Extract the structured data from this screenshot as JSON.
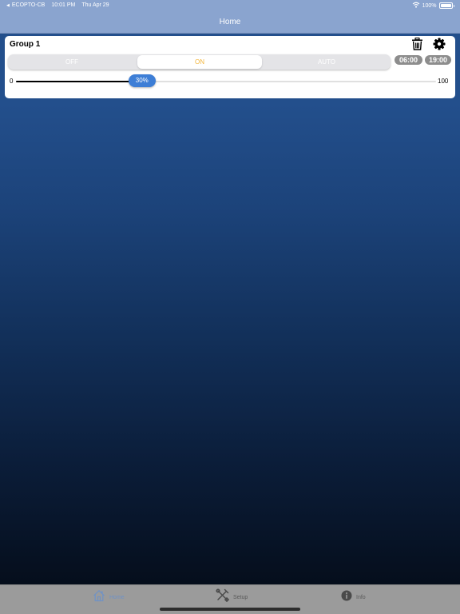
{
  "status_bar": {
    "back_app": "ECOPTO-CB",
    "time": "10:01 PM",
    "date": "Thu Apr 29",
    "battery": "100%",
    "icons": [
      "back-carat-icon",
      "wifi-icon",
      "battery-icon"
    ]
  },
  "nav": {
    "title": "Home"
  },
  "group": {
    "name": "Group 1",
    "mode_options": [
      "OFF",
      "ON",
      "AUTO"
    ],
    "selected_mode": "ON",
    "schedule_start": "06:00",
    "schedule_end": "19:00",
    "slider_min": "0",
    "slider_max": "100",
    "slider_value": 30,
    "slider_label": "30%",
    "icons": [
      "trash-icon",
      "gear-icon"
    ]
  },
  "tabs": [
    {
      "label": "Home",
      "icon": "home-icon",
      "selected": true
    },
    {
      "label": "Setup",
      "icon": "tools-icon",
      "selected": false
    },
    {
      "label": "Info",
      "icon": "info-icon",
      "selected": false
    }
  ],
  "colors": {
    "bar_background": "#8aa4cf",
    "selected_mode_text": "#f2b53c",
    "slider_thumb": "#3d7ed6",
    "selected_tab": "#6f92c6",
    "tabbar_background": "#9b9b9b"
  }
}
